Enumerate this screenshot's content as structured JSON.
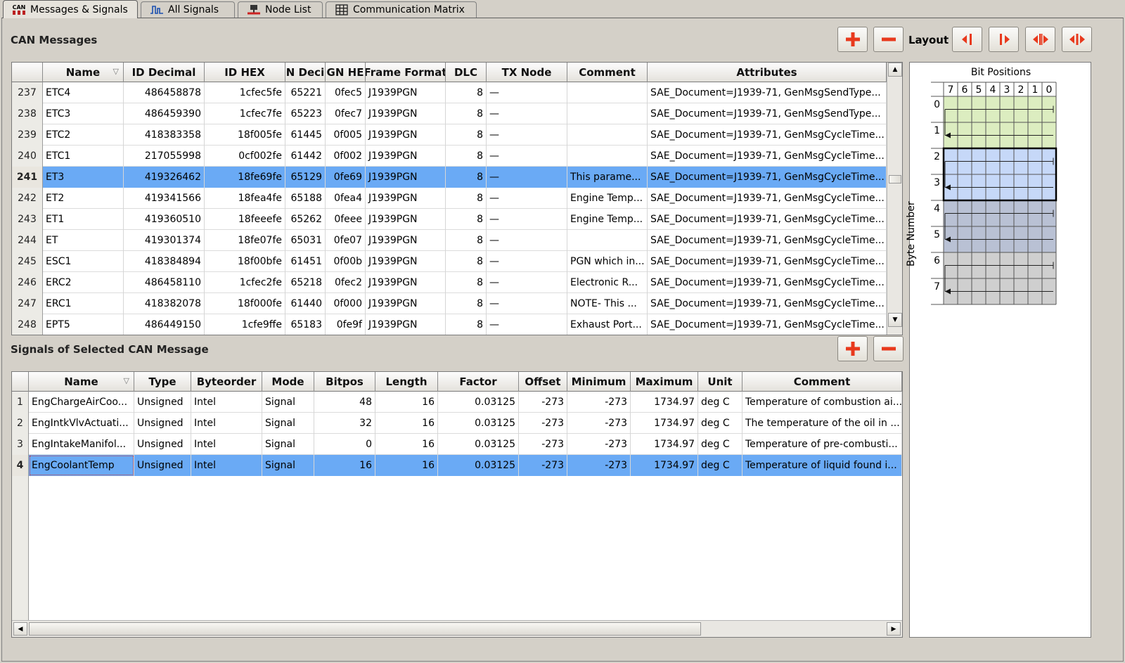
{
  "tabs": [
    {
      "label": "Messages & Signals",
      "icon": "can-bus-icon",
      "icon_text": "CAN"
    },
    {
      "label": "All Signals",
      "icon": "signal-wave-icon"
    },
    {
      "label": "Node List",
      "icon": "node-icon"
    },
    {
      "label": "Communication Matrix",
      "icon": "grid-icon"
    }
  ],
  "messages": {
    "title": "CAN Messages",
    "layout_label": "Layout",
    "columns": [
      "Name",
      "ID Decimal",
      "ID HEX",
      "N Deci",
      "GN HE",
      "Frame Format",
      "DLC",
      "TX Node",
      "Comment",
      "Attributes"
    ],
    "rows": [
      {
        "num": "237",
        "name": "ETC4",
        "iddec": "486458878",
        "idhex": "1cfec5fe",
        "pgn": "65221",
        "pgnhex": "0fec5",
        "frame": "J1939PGN",
        "dlc": "8",
        "tx": "—",
        "comment": "",
        "attr": "SAE_Document=J1939-71, GenMsgSendType..."
      },
      {
        "num": "238",
        "name": "ETC3",
        "iddec": "486459390",
        "idhex": "1cfec7fe",
        "pgn": "65223",
        "pgnhex": "0fec7",
        "frame": "J1939PGN",
        "dlc": "8",
        "tx": "—",
        "comment": "",
        "attr": "SAE_Document=J1939-71, GenMsgSendType..."
      },
      {
        "num": "239",
        "name": "ETC2",
        "iddec": "418383358",
        "idhex": "18f005fe",
        "pgn": "61445",
        "pgnhex": "0f005",
        "frame": "J1939PGN",
        "dlc": "8",
        "tx": "—",
        "comment": "",
        "attr": "SAE_Document=J1939-71, GenMsgCycleTime..."
      },
      {
        "num": "240",
        "name": "ETC1",
        "iddec": "217055998",
        "idhex": "0cf002fe",
        "pgn": "61442",
        "pgnhex": "0f002",
        "frame": "J1939PGN",
        "dlc": "8",
        "tx": "—",
        "comment": "",
        "attr": "SAE_Document=J1939-71, GenMsgCycleTime..."
      },
      {
        "num": "241",
        "name": "ET3",
        "iddec": "419326462",
        "idhex": "18fe69fe",
        "pgn": "65129",
        "pgnhex": "0fe69",
        "frame": "J1939PGN",
        "dlc": "8",
        "tx": "—",
        "comment": "This parame...",
        "attr": "SAE_Document=J1939-71, GenMsgCycleTime...",
        "selected": true
      },
      {
        "num": "242",
        "name": "ET2",
        "iddec": "419341566",
        "idhex": "18fea4fe",
        "pgn": "65188",
        "pgnhex": "0fea4",
        "frame": "J1939PGN",
        "dlc": "8",
        "tx": "—",
        "comment": "Engine Temp...",
        "attr": "SAE_Document=J1939-71, GenMsgCycleTime..."
      },
      {
        "num": "243",
        "name": "ET1",
        "iddec": "419360510",
        "idhex": "18feeefe",
        "pgn": "65262",
        "pgnhex": "0feee",
        "frame": "J1939PGN",
        "dlc": "8",
        "tx": "—",
        "comment": "Engine Temp...",
        "attr": "SAE_Document=J1939-71, GenMsgCycleTime..."
      },
      {
        "num": "244",
        "name": "ET",
        "iddec": "419301374",
        "idhex": "18fe07fe",
        "pgn": "65031",
        "pgnhex": "0fe07",
        "frame": "J1939PGN",
        "dlc": "8",
        "tx": "—",
        "comment": "",
        "attr": "SAE_Document=J1939-71, GenMsgCycleTime..."
      },
      {
        "num": "245",
        "name": "ESC1",
        "iddec": "418384894",
        "idhex": "18f00bfe",
        "pgn": "61451",
        "pgnhex": "0f00b",
        "frame": "J1939PGN",
        "dlc": "8",
        "tx": "—",
        "comment": "PGN which in...",
        "attr": "SAE_Document=J1939-71, GenMsgCycleTime..."
      },
      {
        "num": "246",
        "name": "ERC2",
        "iddec": "486458110",
        "idhex": "1cfec2fe",
        "pgn": "65218",
        "pgnhex": "0fec2",
        "frame": "J1939PGN",
        "dlc": "8",
        "tx": "—",
        "comment": "Electronic R...",
        "attr": "SAE_Document=J1939-71, GenMsgCycleTime..."
      },
      {
        "num": "247",
        "name": "ERC1",
        "iddec": "418382078",
        "idhex": "18f000fe",
        "pgn": "61440",
        "pgnhex": "0f000",
        "frame": "J1939PGN",
        "dlc": "8",
        "tx": "—",
        "comment": "NOTE- This ...",
        "attr": "SAE_Document=J1939-71, GenMsgCycleTime..."
      },
      {
        "num": "248",
        "name": "EPT5",
        "iddec": "486449150",
        "idhex": "1cfe9ffe",
        "pgn": "65183",
        "pgnhex": "0fe9f",
        "frame": "J1939PGN",
        "dlc": "8",
        "tx": "—",
        "comment": "Exhaust Port...",
        "attr": "SAE_Document=J1939-71, GenMsgCycleTime..."
      }
    ]
  },
  "signals": {
    "title": "Signals of Selected CAN Message",
    "columns": [
      "Name",
      "Type",
      "Byteorder",
      "Mode",
      "Bitpos",
      "Length",
      "Factor",
      "Offset",
      "Minimum",
      "Maximum",
      "Unit",
      "Comment"
    ],
    "rows": [
      {
        "num": "1",
        "name": "EngChargeAirCoo...",
        "type": "Unsigned",
        "order": "Intel",
        "mode": "Signal",
        "bitpos": "48",
        "length": "16",
        "factor": "0.03125",
        "offset": "-273",
        "min": "-273",
        "max": "1734.97",
        "unit": "deg C",
        "comment": "Temperature of combustion ai..."
      },
      {
        "num": "2",
        "name": "EngIntkVlvActuati...",
        "type": "Unsigned",
        "order": "Intel",
        "mode": "Signal",
        "bitpos": "32",
        "length": "16",
        "factor": "0.03125",
        "offset": "-273",
        "min": "-273",
        "max": "1734.97",
        "unit": "deg C",
        "comment": "The temperature of the oil in ..."
      },
      {
        "num": "3",
        "name": "EngIntakeManifol...",
        "type": "Unsigned",
        "order": "Intel",
        "mode": "Signal",
        "bitpos": "0",
        "length": "16",
        "factor": "0.03125",
        "offset": "-273",
        "min": "-273",
        "max": "1734.97",
        "unit": "deg C",
        "comment": "Temperature of pre-combusti..."
      },
      {
        "num": "4",
        "name": "EngCoolantTemp",
        "type": "Unsigned",
        "order": "Intel",
        "mode": "Signal",
        "bitpos": "16",
        "length": "16",
        "factor": "0.03125",
        "offset": "-273",
        "min": "-273",
        "max": "1734.97",
        "unit": "deg C",
        "comment": "Temperature of liquid found i...",
        "selected": true
      }
    ]
  },
  "bit_positions": {
    "title": "Bit Positions",
    "y_label": "Byte Number",
    "bit_labels": [
      "7",
      "6",
      "5",
      "4",
      "3",
      "2",
      "1",
      "0"
    ],
    "byte_labels": [
      "0",
      "1",
      "2",
      "3",
      "4",
      "5",
      "6",
      "7"
    ],
    "byte_colors": [
      "#dcedc0",
      "#dcedc0",
      "#c6d8f8",
      "#c6d8f8",
      "#b9c1d4",
      "#b9c1d4",
      "#cfcfcf",
      "#cfcfcf"
    ],
    "selected_bytes": [
      2,
      3
    ]
  },
  "colors": {
    "selection": "#6aaaf5",
    "accent_red": "#e8391d"
  }
}
